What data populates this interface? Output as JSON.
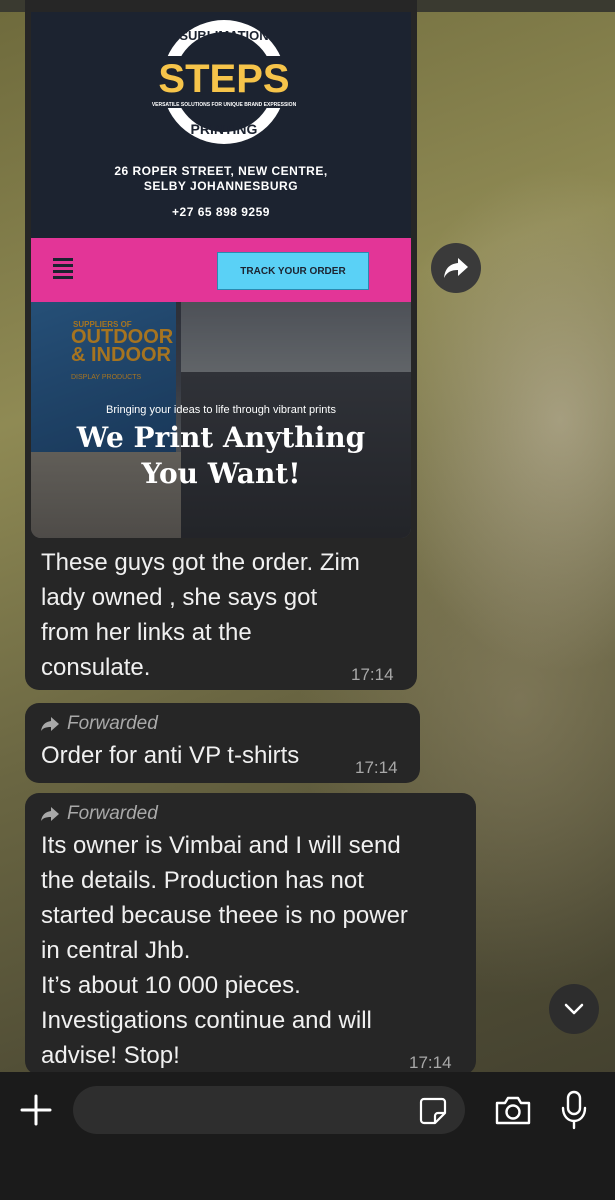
{
  "ad": {
    "logo_top": "SUBLIMATION",
    "logo_main": "STEPS",
    "logo_tagline": "VERSATILE SOLUTIONS FOR UNIQUE BRAND EXPRESSION",
    "logo_bottom": "PRINTING",
    "address_line1": "26 ROPER STREET, NEW CENTRE,",
    "address_line2": "SELBY JOHANNESBURG",
    "phone": "+27 65 898 9259",
    "track_button": "TRACK YOUR ORDER",
    "banner_small": "SUPPLIERS OF",
    "banner_large_1": "OUTDOOR",
    "banner_large_2": "& INDOOR",
    "banner_sub": "DISPLAY PRODUCTS",
    "tagline": "Bringing your ideas to life through vibrant prints",
    "headline_1": "We Print Anything",
    "headline_2": "You Want!"
  },
  "messages": [
    {
      "lines": [
        "These guys got the order. Zim",
        "lady owned , she says got",
        "from her links at the",
        "consulate."
      ],
      "time": "17:14"
    },
    {
      "forwarded_label": "Forwarded",
      "lines": [
        "Order for anti VP t-shirts"
      ],
      "time": "17:14"
    },
    {
      "forwarded_label": "Forwarded",
      "lines": [
        "Its owner is Vimbai and I will send",
        "the details. Production has not",
        "started because theee is no power",
        "in central Jhb.",
        "It’s about 10 000 pieces.",
        "Investigations continue and will",
        "advise! Stop!"
      ],
      "time": "17:14"
    }
  ],
  "icons": {
    "share": "share-forward-icon",
    "scroll_down": "chevron-down-icon",
    "plus": "plus-icon",
    "sticker": "sticker-icon",
    "camera": "camera-icon",
    "mic": "microphone-icon"
  },
  "colors": {
    "bubble": "#262626",
    "pink_bar": "#e33597",
    "track_button": "#5ad1f6",
    "ad_header": "#1c2330"
  }
}
